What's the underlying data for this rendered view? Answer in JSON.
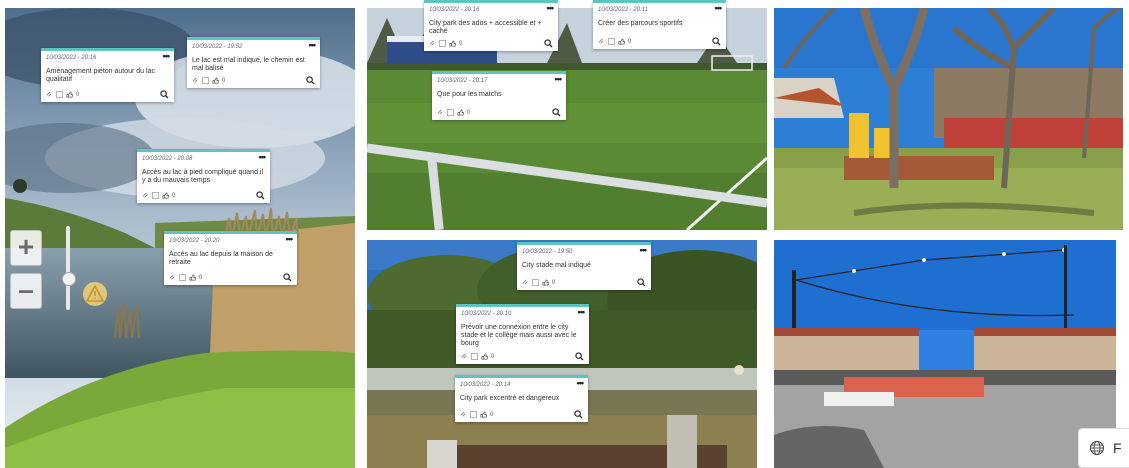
{
  "notes": [
    {
      "date": "10/03/2022 - 20:16",
      "text": "Aménagement piéton autour du lac qualitatif",
      "likes": "0"
    },
    {
      "date": "10/03/2022 - 19:52",
      "text": "Le lac est mal indiqué, le chemin est mal balisé",
      "likes": "0"
    },
    {
      "date": "10/03/2022 - 20:08",
      "text": "Accès au lac à pied compliqué quand il y a du mauvais temps",
      "likes": "0"
    },
    {
      "date": "10/03/2022 - 20:20",
      "text": "Accès au lac depuis la maison de retraite",
      "likes": "0"
    },
    {
      "date": "10/03/2022 - 20:16",
      "text": "City park des ados + accessible et + caché",
      "likes": "0"
    },
    {
      "date": "10/03/2022 - 20:11",
      "text": "Créer des parcours sportifs",
      "likes": "0"
    },
    {
      "date": "10/03/2022 - 20:17",
      "text": "Que pour les matchs",
      "likes": "0"
    },
    {
      "date": "10/03/2022 - 19:50",
      "text": "City stade mal indiqué",
      "likes": "0"
    },
    {
      "date": "10/03/2022 - 20:10",
      "text": "Prévoir une connexion entre le city stade et le collège mais aussi avec le bourg",
      "likes": "0"
    },
    {
      "date": "10/03/2022 - 20:14",
      "text": "City park excentré et dangereux",
      "likes": "0"
    }
  ],
  "map_controls": {
    "zoom_in": "+",
    "zoom_out": "–",
    "zoom_level": 0.5
  },
  "language_button": {
    "label": "F"
  },
  "colors": {
    "note_accent": "#5fc4bf",
    "sky": "#1f6fd1",
    "grass": "#6aa83a",
    "court": "#d9634d"
  }
}
